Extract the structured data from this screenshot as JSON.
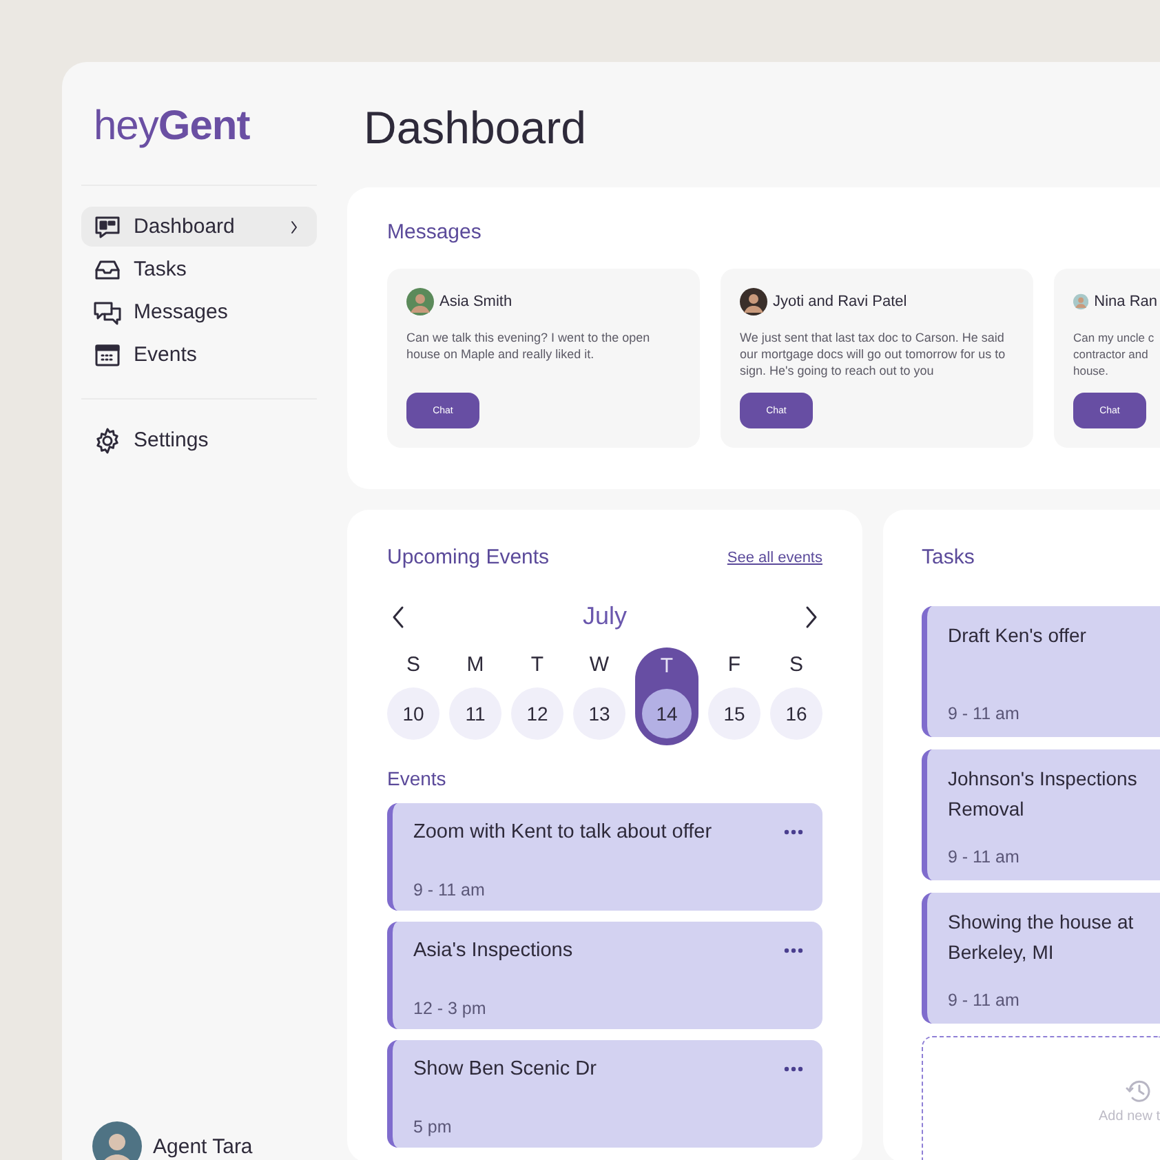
{
  "sidebar": {
    "logo": {
      "light": "hey",
      "bold": "Gent"
    },
    "items": [
      {
        "label": "Dashboard",
        "selected": true
      },
      {
        "label": "Tasks",
        "selected": false
      },
      {
        "label": "Messages",
        "selected": false
      },
      {
        "label": "Events",
        "selected": false
      }
    ],
    "settings": {
      "label": "Settings"
    },
    "user": {
      "name": "Agent Tara"
    }
  },
  "page_title": "Dashboard",
  "messages": {
    "title": "Messages",
    "cards": [
      {
        "name": "Asia Smith",
        "text": "Can we talk this evening? I went to the open house on Maple and really liked it.",
        "button": "Chat"
      },
      {
        "name": "Jyoti and Ravi Patel",
        "text": "We just sent that last tax doc to Carson. He said our mortgage docs will go out tomorrow for us to sign. He's going to reach out to you",
        "button": "Chat"
      },
      {
        "name": "Nina Ran",
        "text": "Can my uncle c contractor and house.",
        "button": "Chat"
      }
    ]
  },
  "upcoming": {
    "title": "Upcoming Events",
    "link": "See all events",
    "month": "July",
    "days": [
      {
        "weekday": "S",
        "date": "10",
        "selected": false
      },
      {
        "weekday": "M",
        "date": "11",
        "selected": false
      },
      {
        "weekday": "T",
        "date": "12",
        "selected": false
      },
      {
        "weekday": "W",
        "date": "13",
        "selected": false
      },
      {
        "weekday": "T",
        "date": "14",
        "selected": true
      },
      {
        "weekday": "F",
        "date": "15",
        "selected": false
      },
      {
        "weekday": "S",
        "date": "16",
        "selected": false
      }
    ],
    "events_title": "Events",
    "events": [
      {
        "title": "Zoom with Kent to talk about offer",
        "time": "9 - 11 am"
      },
      {
        "title": "Asia's Inspections",
        "time": "12 - 3 pm"
      },
      {
        "title": "Show Ben Scenic Dr",
        "time": "5 pm"
      }
    ]
  },
  "tasks": {
    "title": "Tasks",
    "items": [
      {
        "title": "Draft Ken's offer",
        "time": "9 - 11 am"
      },
      {
        "title": "Johnson's Inspections Removal",
        "time": "9 - 11 am"
      },
      {
        "title": "Showing the house at Berkeley, MI",
        "time": "9 - 11 am"
      }
    ],
    "add_label": "Add new t"
  }
}
